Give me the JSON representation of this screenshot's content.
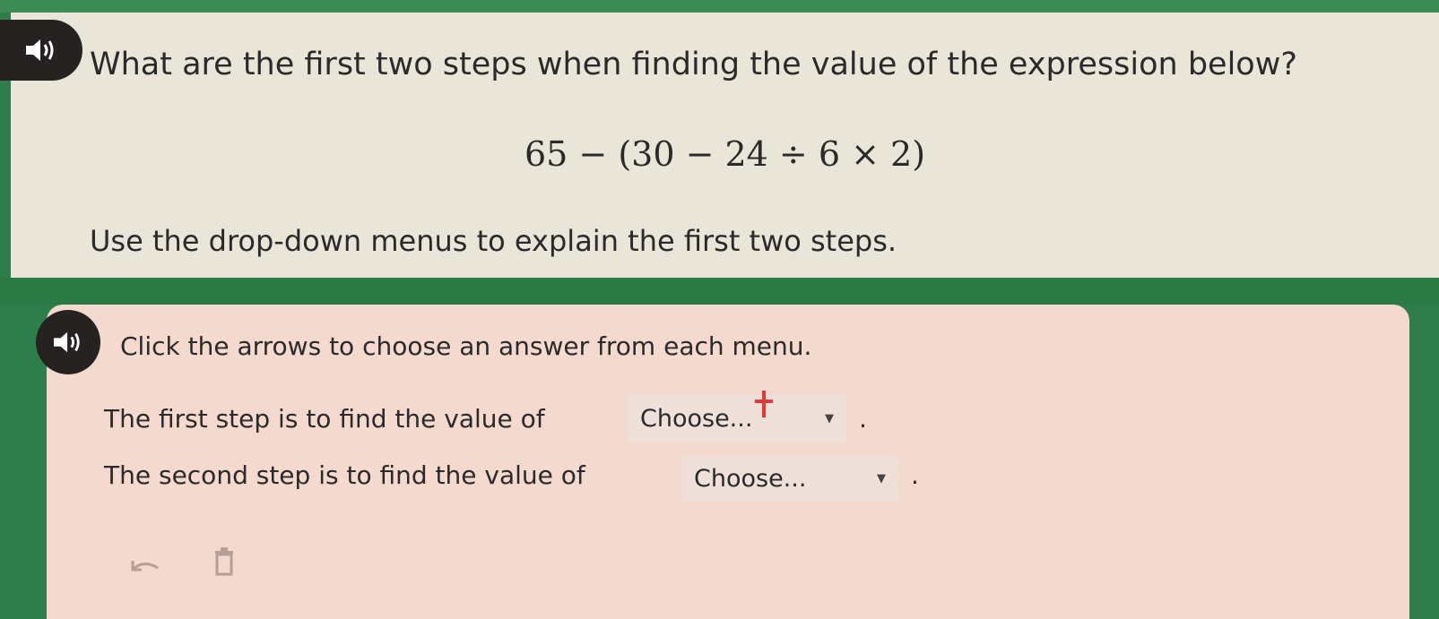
{
  "question": {
    "title": "What are the first two steps when finding the value of the expression below?",
    "expression": "65 − (30 − 24 ÷ 6 × 2)",
    "instruction": "Use the drop-down menus to explain the first two steps."
  },
  "answer": {
    "prompt": "Click the arrows to choose an answer from each menu.",
    "rows": [
      {
        "text": "The first step is to find the value of",
        "selected": "Choose...",
        "end": "."
      },
      {
        "text": "The second step is to find the value of",
        "selected": "Choose...",
        "end": "."
      }
    ]
  },
  "icons": {
    "question_audio": "speaker-icon",
    "answer_audio": "speaker-icon",
    "undo": "undo-icon",
    "reset": "trash-icon",
    "cursor": "red-cursor-icon"
  },
  "colors": {
    "background": "#2e7d4a",
    "question_panel": "#e9e6d9",
    "answer_panel": "#f4d9cf",
    "dropdown": "#efe0da",
    "cursor": "#e53935"
  }
}
